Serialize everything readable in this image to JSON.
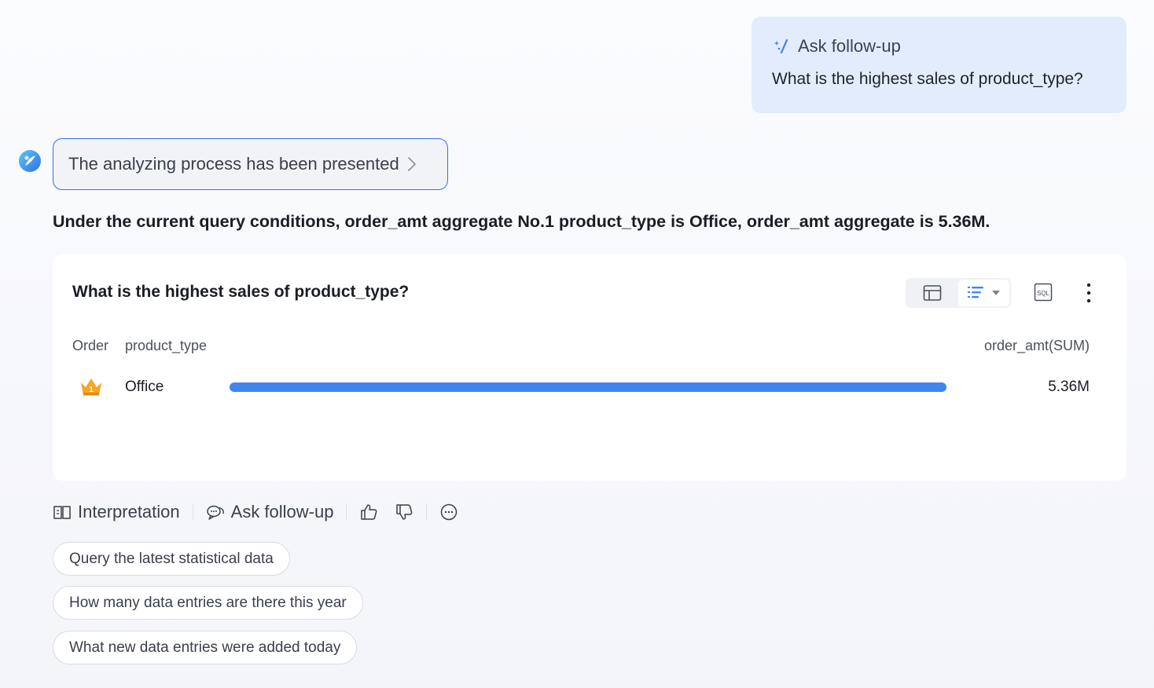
{
  "followup_bubble": {
    "label": "Ask follow-up",
    "question": "What is the highest sales of product_type?"
  },
  "process": {
    "label": "The analyzing process has been presented"
  },
  "answer_text": "Under the current query conditions, order_amt aggregate No.1 product_type is Office, order_amt aggregate is 5.36M.",
  "card": {
    "title": "What is the highest sales of product_type?",
    "columns": {
      "order": "Order",
      "type": "product_type",
      "amount": "order_amt(SUM)"
    },
    "rows": [
      {
        "rank": 1,
        "product_type": "Office",
        "value_label": "5.36M",
        "share": 1.0
      }
    ],
    "bar_color": "#3f86f0"
  },
  "actions": {
    "interpretation": "Interpretation",
    "ask_followup": "Ask follow-up"
  },
  "suggestions": [
    "Query the latest statistical data",
    "How many data entries are there this year",
    "What new data entries were added today"
  ],
  "colors": {
    "accent": "#3b6fe4",
    "bubble": "#e3ecfc",
    "crown": "#f5a623"
  }
}
